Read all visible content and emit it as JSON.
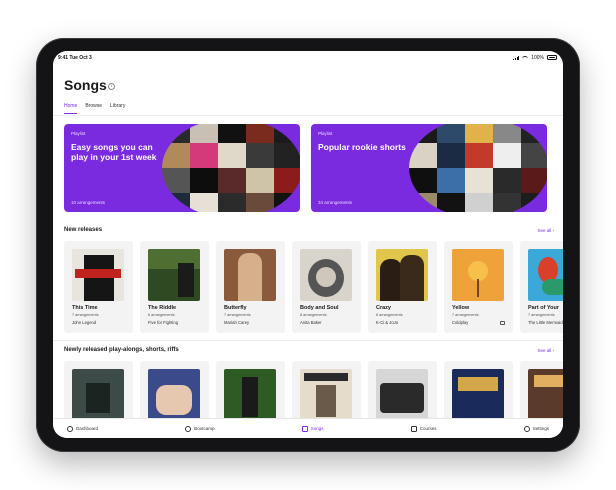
{
  "status_bar": {
    "time": "9:41  Tue Oct 3",
    "battery": "100%"
  },
  "page": {
    "title": "Songs",
    "info_icon": "i"
  },
  "tabs": [
    {
      "label": "Home",
      "active": true
    },
    {
      "label": "Browse",
      "active": false
    },
    {
      "label": "Library",
      "active": false
    }
  ],
  "banners": [
    {
      "eyebrow": "Playlist",
      "title": "Easy songs you can play in your 1st week",
      "count": "10 arrangements"
    },
    {
      "eyebrow": "Playlist",
      "title": "Popular rookie shorts",
      "count": "34 arrangements"
    }
  ],
  "new_releases": {
    "title": "New releases",
    "see_all": "See all  ›",
    "items": [
      {
        "name": "This Time",
        "arrangements": "7 arrangements",
        "artist": "John Legend"
      },
      {
        "name": "The Riddle",
        "arrangements": "6 arrangements",
        "artist": "Five for Fighting"
      },
      {
        "name": "Butterfly",
        "arrangements": "7 arrangements",
        "artist": "Mariah Carey"
      },
      {
        "name": "Body and Soul",
        "arrangements": "8 arrangements",
        "artist": "Anita Baker"
      },
      {
        "name": "Crazy",
        "arrangements": "8 arrangements",
        "artist": "K-Ci & JoJo"
      },
      {
        "name": "Yellow",
        "arrangements": "7 arrangements",
        "artist": "Coldplay"
      },
      {
        "name": "Part of Your",
        "arrangements": "7 arrangements",
        "artist": "The Little Mermaid"
      }
    ]
  },
  "newly_released": {
    "title": "Newly released play-alongs, shorts, riffs",
    "see_all": "See all  ›",
    "count": 7
  },
  "bottom_nav": [
    {
      "label": "Dashboard",
      "icon": "dashboard-icon",
      "active": false
    },
    {
      "label": "Bootcamp",
      "icon": "bootcamp-icon",
      "active": false
    },
    {
      "label": "Songs",
      "icon": "songs-icon",
      "active": true
    },
    {
      "label": "Courses",
      "icon": "courses-icon",
      "active": false
    },
    {
      "label": "Settings",
      "icon": "settings-icon",
      "active": false
    }
  ],
  "colors": {
    "accent": "#7a2be0",
    "card_bg": "#f3f3f3"
  }
}
